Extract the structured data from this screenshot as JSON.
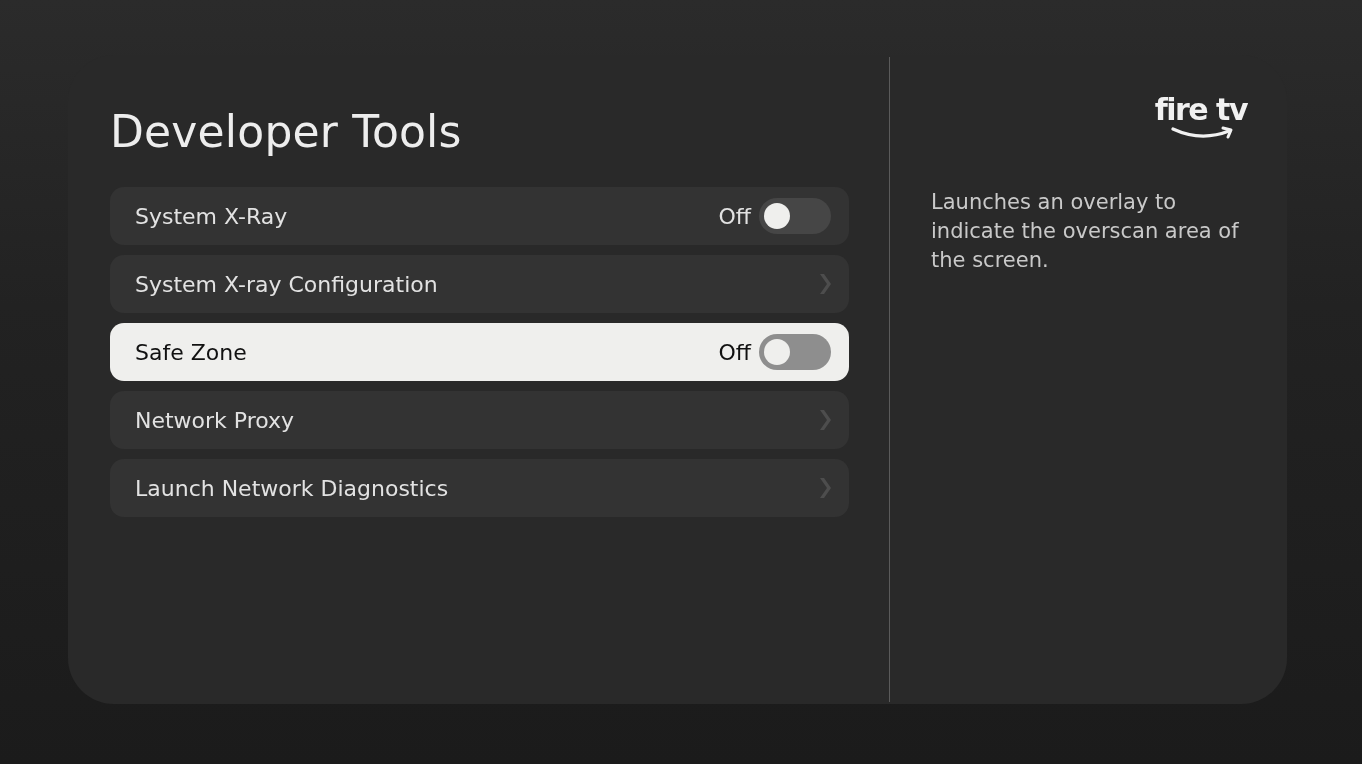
{
  "screen": {
    "title": "Developer Tools"
  },
  "settings": [
    {
      "kind": "toggle",
      "label": "System X-Ray",
      "value": "Off",
      "on": false,
      "selected": false
    },
    {
      "kind": "link",
      "label": "System X-ray Configuration",
      "selected": false
    },
    {
      "kind": "toggle",
      "label": "Safe Zone",
      "value": "Off",
      "on": false,
      "selected": true
    },
    {
      "kind": "link",
      "label": "Network Proxy",
      "selected": false
    },
    {
      "kind": "link",
      "label": "Launch Network Diagnostics",
      "selected": false
    }
  ],
  "logo": {
    "text": "fire tv"
  },
  "description": "Launches an overlay to indicate the overscan area of the screen."
}
